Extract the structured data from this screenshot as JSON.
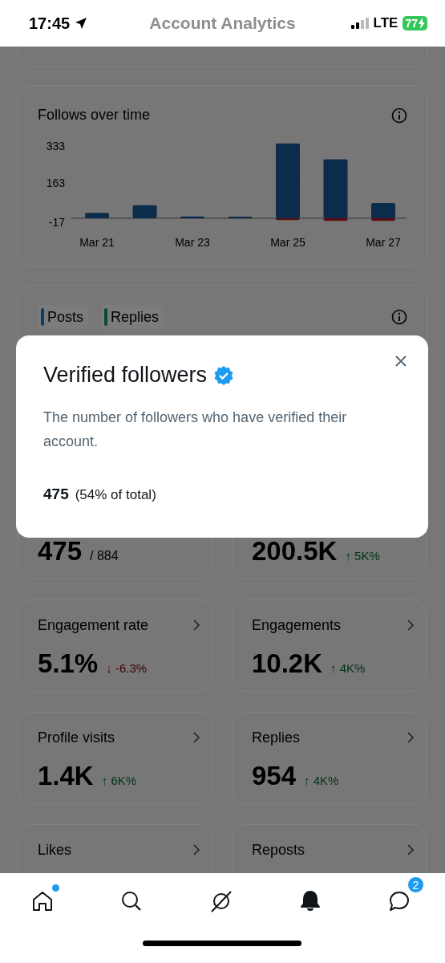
{
  "status_bar": {
    "time": "17:45",
    "network": "LTE",
    "battery": "77"
  },
  "header": {
    "title": "Account Analytics"
  },
  "follows_card": {
    "title": "Follows over time",
    "chart_data": {
      "type": "bar",
      "categories": [
        "Mar 21",
        null,
        "Mar 23",
        null,
        "Mar 25",
        null,
        "Mar 27"
      ],
      "yticks": [
        333,
        163,
        -17
      ],
      "ylim": [
        -20,
        350
      ],
      "series": [
        {
          "color": "#0b2c4a",
          "values": [
            25,
            60,
            8,
            7,
            345,
            272,
            70
          ]
        },
        {
          "color": "#5c0d12",
          "values": [
            0,
            0,
            0,
            0,
            -8,
            -12,
            -12
          ]
        }
      ]
    }
  },
  "posts_card": {
    "tabs": [
      {
        "label": "Posts",
        "color": "#0b3f66"
      },
      {
        "label": "Replies",
        "color": "#0a4a30"
      }
    ]
  },
  "stats": [
    {
      "value": "475",
      "total": "/ 884"
    },
    {
      "value": "200.5K",
      "change": "↑ 5K%",
      "color": "#003318"
    },
    {
      "title": "Engagement rate",
      "value": "5.1%",
      "change": "↓ -6.3%",
      "color": "#400008"
    },
    {
      "title": "Engagements",
      "value": "10.2K",
      "change": "↑ 4K%",
      "color": "#003318"
    },
    {
      "title": "Profile visits",
      "value": "1.4K",
      "change": "↑ 6K%",
      "color": "#003318"
    },
    {
      "title": "Replies",
      "value": "954",
      "change": "↑ 4K%",
      "color": "#003318"
    },
    {
      "title": "Likes"
    },
    {
      "title": "Reposts"
    }
  ],
  "dialog": {
    "title": "Verified followers",
    "description": "The number of followers who have verified their account.",
    "count": "475",
    "share": "(54% of total)"
  },
  "bottom_nav": [
    {
      "kind": "home",
      "dot": true
    },
    {
      "kind": "search"
    },
    {
      "kind": "grok"
    },
    {
      "kind": "notifications"
    },
    {
      "kind": "messages",
      "badge": "2"
    }
  ]
}
